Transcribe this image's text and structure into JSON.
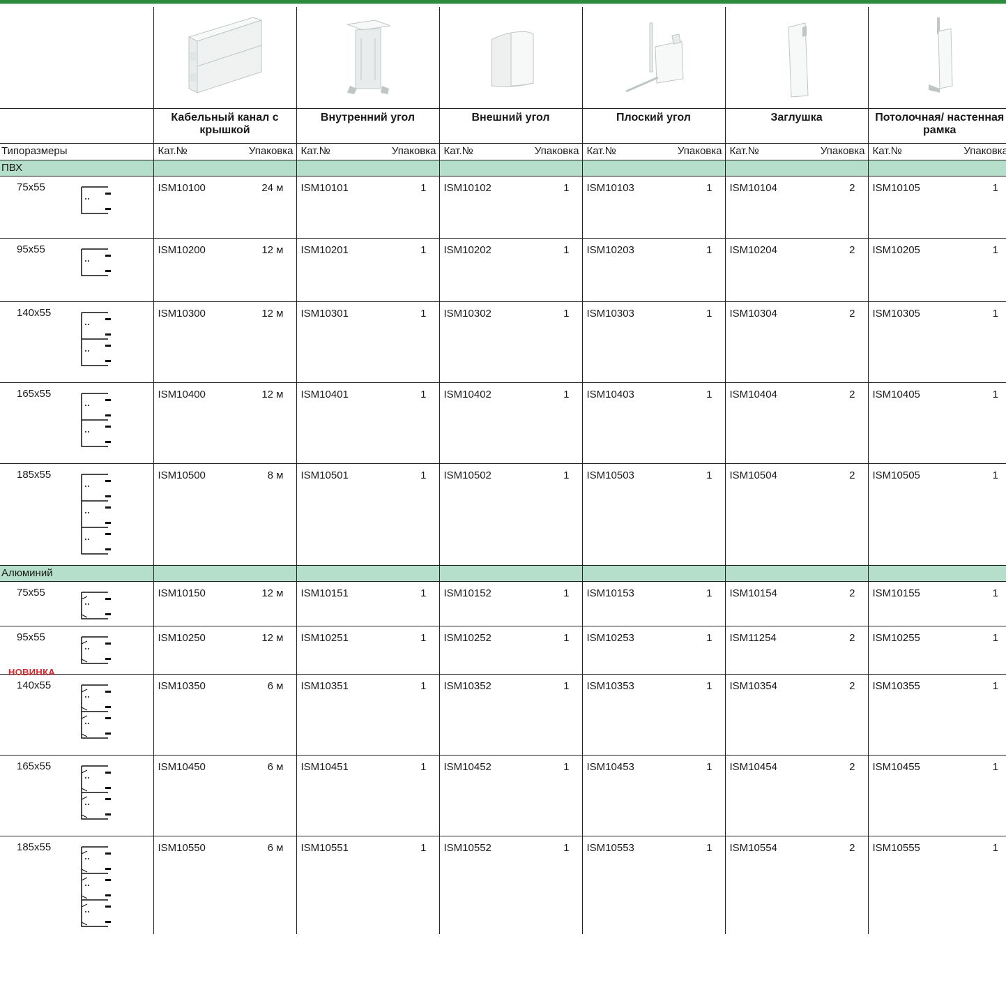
{
  "header": {
    "columns": [
      {
        "title": "Кабельный канал с крышкой",
        "image": "cable-channel-with-cover"
      },
      {
        "title": "Внутренний угол",
        "image": "inner-corner"
      },
      {
        "title": "Внешний угол",
        "image": "outer-corner"
      },
      {
        "title": "Плоский угол",
        "image": "flat-corner"
      },
      {
        "title": "Заглушка",
        "image": "end-cap"
      },
      {
        "title": "Потолочная/ настенная рамка",
        "image": "ceiling-wall-frame"
      }
    ],
    "size_label": "Типоразмеры",
    "cat_label": "Кат.№",
    "pack_label": "Упаковка"
  },
  "sections": [
    {
      "name": "ПВХ",
      "rows": [
        {
          "size": "75x55",
          "profile": "pvc-1",
          "items": [
            [
              "ISM10100",
              "24 м"
            ],
            [
              "ISM10101",
              "1"
            ],
            [
              "ISM10102",
              "1"
            ],
            [
              "ISM10103",
              "1"
            ],
            [
              "ISM10104",
              "2"
            ],
            [
              "ISM10105",
              "1"
            ]
          ]
        },
        {
          "size": "95x55",
          "profile": "pvc-1",
          "items": [
            [
              "ISM10200",
              "12 м"
            ],
            [
              "ISM10201",
              "1"
            ],
            [
              "ISM10202",
              "1"
            ],
            [
              "ISM10203",
              "1"
            ],
            [
              "ISM10204",
              "2"
            ],
            [
              "ISM10205",
              "1"
            ]
          ]
        },
        {
          "size": "140x55",
          "profile": "pvc-2",
          "items": [
            [
              "ISM10300",
              "12 м"
            ],
            [
              "ISM10301",
              "1"
            ],
            [
              "ISM10302",
              "1"
            ],
            [
              "ISM10303",
              "1"
            ],
            [
              "ISM10304",
              "2"
            ],
            [
              "ISM10305",
              "1"
            ]
          ]
        },
        {
          "size": "165x55",
          "profile": "pvc-2",
          "items": [
            [
              "ISM10400",
              "12 м"
            ],
            [
              "ISM10401",
              "1"
            ],
            [
              "ISM10402",
              "1"
            ],
            [
              "ISM10403",
              "1"
            ],
            [
              "ISM10404",
              "2"
            ],
            [
              "ISM10405",
              "1"
            ]
          ]
        },
        {
          "size": "185x55",
          "profile": "pvc-3",
          "items": [
            [
              "ISM10500",
              "8 м"
            ],
            [
              "ISM10501",
              "1"
            ],
            [
              "ISM10502",
              "1"
            ],
            [
              "ISM10503",
              "1"
            ],
            [
              "ISM10504",
              "2"
            ],
            [
              "ISM10505",
              "1"
            ]
          ]
        }
      ]
    },
    {
      "name": "Алюминий",
      "rows": [
        {
          "size": "75x55",
          "profile": "alu-1",
          "items": [
            [
              "ISM10150",
              "12 м"
            ],
            [
              "ISM10151",
              "1"
            ],
            [
              "ISM10152",
              "1"
            ],
            [
              "ISM10153",
              "1"
            ],
            [
              "ISM10154",
              "2"
            ],
            [
              "ISM10155",
              "1"
            ]
          ]
        },
        {
          "size": "95x55",
          "badge": "НОВИНКА",
          "profile": "alu-1",
          "items": [
            [
              "ISM10250",
              "12 м"
            ],
            [
              "ISM10251",
              "1"
            ],
            [
              "ISM10252",
              "1"
            ],
            [
              "ISM10253",
              "1"
            ],
            [
              "ISM11254",
              "2"
            ],
            [
              "ISM10255",
              "1"
            ]
          ]
        },
        {
          "size": "140x55",
          "profile": "alu-2",
          "items": [
            [
              "ISM10350",
              "6 м"
            ],
            [
              "ISM10351",
              "1"
            ],
            [
              "ISM10352",
              "1"
            ],
            [
              "ISM10353",
              "1"
            ],
            [
              "ISM10354",
              "2"
            ],
            [
              "ISM10355",
              "1"
            ]
          ]
        },
        {
          "size": "165x55",
          "profile": "alu-2",
          "items": [
            [
              "ISM10450",
              "6 м"
            ],
            [
              "ISM10451",
              "1"
            ],
            [
              "ISM10452",
              "1"
            ],
            [
              "ISM10453",
              "1"
            ],
            [
              "ISM10454",
              "2"
            ],
            [
              "ISM10455",
              "1"
            ]
          ]
        },
        {
          "size": "185x55",
          "profile": "alu-3",
          "items": [
            [
              "ISM10550",
              "6 м"
            ],
            [
              "ISM10551",
              "1"
            ],
            [
              "ISM10552",
              "1"
            ],
            [
              "ISM10553",
              "1"
            ],
            [
              "ISM10554",
              "2"
            ],
            [
              "ISM10555",
              "1"
            ]
          ]
        }
      ]
    }
  ]
}
